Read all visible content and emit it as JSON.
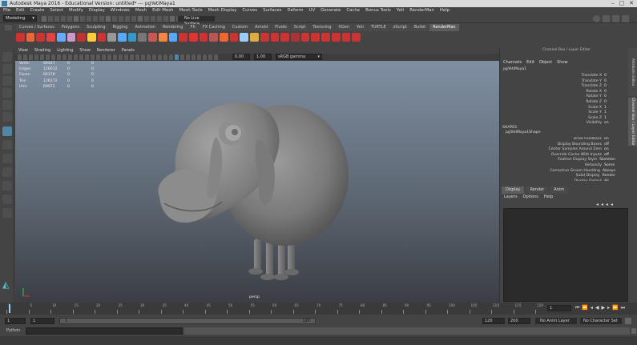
{
  "window": {
    "title": "Autodesk Maya 2016 - Educational Version: untitled*    ---    pgYetiMaya1",
    "controls": [
      "–",
      "□",
      "✕"
    ]
  },
  "menubar": [
    "File",
    "Edit",
    "Create",
    "Select",
    "Modify",
    "Display",
    "Windows",
    "Mesh",
    "Edit Mesh",
    "Mesh Tools",
    "Mesh Display",
    "Curves",
    "Surfaces",
    "Deform",
    "UV",
    "Generate",
    "Cache",
    "Bonus Tools",
    "Yeti",
    "RenderMan",
    "Help"
  ],
  "statusline": {
    "mode": "Modeling",
    "live_surface": "No Live Surface"
  },
  "shelf_tabs": [
    "Curves / Surfaces",
    "Polygons",
    "Sculpting",
    "Rigging",
    "Animation",
    "Rendering",
    "FX",
    "FX Caching",
    "Custom",
    "Arnold",
    "Fluids",
    "Script",
    "Texturing",
    "XGen",
    "Yeti",
    "TURTLE",
    "zScript",
    "Bullet",
    "RenderMan"
  ],
  "shelf_active": "RenderMan",
  "panel_menu": [
    "View",
    "Shading",
    "Lighting",
    "Show",
    "Renderer",
    "Panels"
  ],
  "panel_toolbar": {
    "near": "0.00",
    "far": "1.00",
    "colorspace": "sRGB gamma"
  },
  "hud": {
    "rows": [
      {
        "label": "Verts:",
        "a": "60447",
        "b": "0",
        "c": "0"
      },
      {
        "label": "Edges:",
        "a": "126012",
        "b": "0",
        "c": "0"
      },
      {
        "label": "Faces:",
        "a": "66178",
        "b": "0",
        "c": "0"
      },
      {
        "label": "Tris:",
        "a": "126272",
        "b": "0",
        "c": "0"
      },
      {
        "label": "UVs:",
        "a": "69972",
        "b": "0",
        "c": "0"
      }
    ],
    "camera": "persp"
  },
  "channel_box": {
    "title": "Channel Box / Layer Editor",
    "menu": [
      "Channels",
      "Edit",
      "Object",
      "Show"
    ],
    "object": "pgYetiMaya1",
    "attrs": [
      {
        "name": "Translate X",
        "value": "0"
      },
      {
        "name": "Translate Y",
        "value": "0"
      },
      {
        "name": "Translate Z",
        "value": "0"
      },
      {
        "name": "Rotate X",
        "value": "0"
      },
      {
        "name": "Rotate Y",
        "value": "0"
      },
      {
        "name": "Rotate Z",
        "value": "0"
      },
      {
        "name": "Scale X",
        "value": "1"
      },
      {
        "name": "Scale Y",
        "value": "1"
      },
      {
        "name": "Scale Z",
        "value": "1"
      },
      {
        "name": "Visibility",
        "value": "on"
      }
    ],
    "shapes_label": "SHAPES",
    "shape_name": "pgYetiMaya1Shape",
    "shape_attrs": [
      {
        "name": "Draw Feedback",
        "value": "on"
      },
      {
        "name": "Display Bounding Boxes",
        "value": "off"
      },
      {
        "name": "Center Samples Around Zero",
        "value": "on"
      },
      {
        "name": "Override Cache With Inputs",
        "value": "off"
      },
      {
        "name": "Feather Display Style",
        "value": "Skeleton"
      },
      {
        "name": "Verbosity",
        "value": "Some"
      },
      {
        "name": "Corrective Groom Handling",
        "value": "Always"
      },
      {
        "name": "Subd Display",
        "value": "Render"
      },
      {
        "name": "Display Output",
        "value": "All"
      }
    ]
  },
  "layer_editor": {
    "tabs": [
      "Display",
      "Render",
      "Anim"
    ],
    "menu": [
      "Layers",
      "Options",
      "Help"
    ]
  },
  "side_tabs": [
    "Attribute Editor",
    "Channel Box / Layer Editor"
  ],
  "timeline": {
    "ticks": [
      "1",
      "5",
      "10",
      "15",
      "20",
      "25",
      "30",
      "35",
      "40",
      "45",
      "50",
      "55",
      "60",
      "65",
      "70",
      "75",
      "80",
      "85",
      "90",
      "95",
      "100",
      "105",
      "110",
      "115",
      "120"
    ],
    "current_frame": "1"
  },
  "range": {
    "start": "1",
    "playback_start": "1",
    "slider_start": "1",
    "slider_end": "120",
    "playback_end": "120",
    "end": "200",
    "anim_layer": "No Anim Layer",
    "char_set": "No Character Set"
  },
  "command": {
    "language": "Python"
  },
  "colors": {
    "title_bg": "#d9d9d9",
    "ui_bg": "#444444",
    "viewport_top": "#7f8fa2",
    "viewport_bottom": "#3b3e44",
    "accent_active": "#5285a6"
  }
}
